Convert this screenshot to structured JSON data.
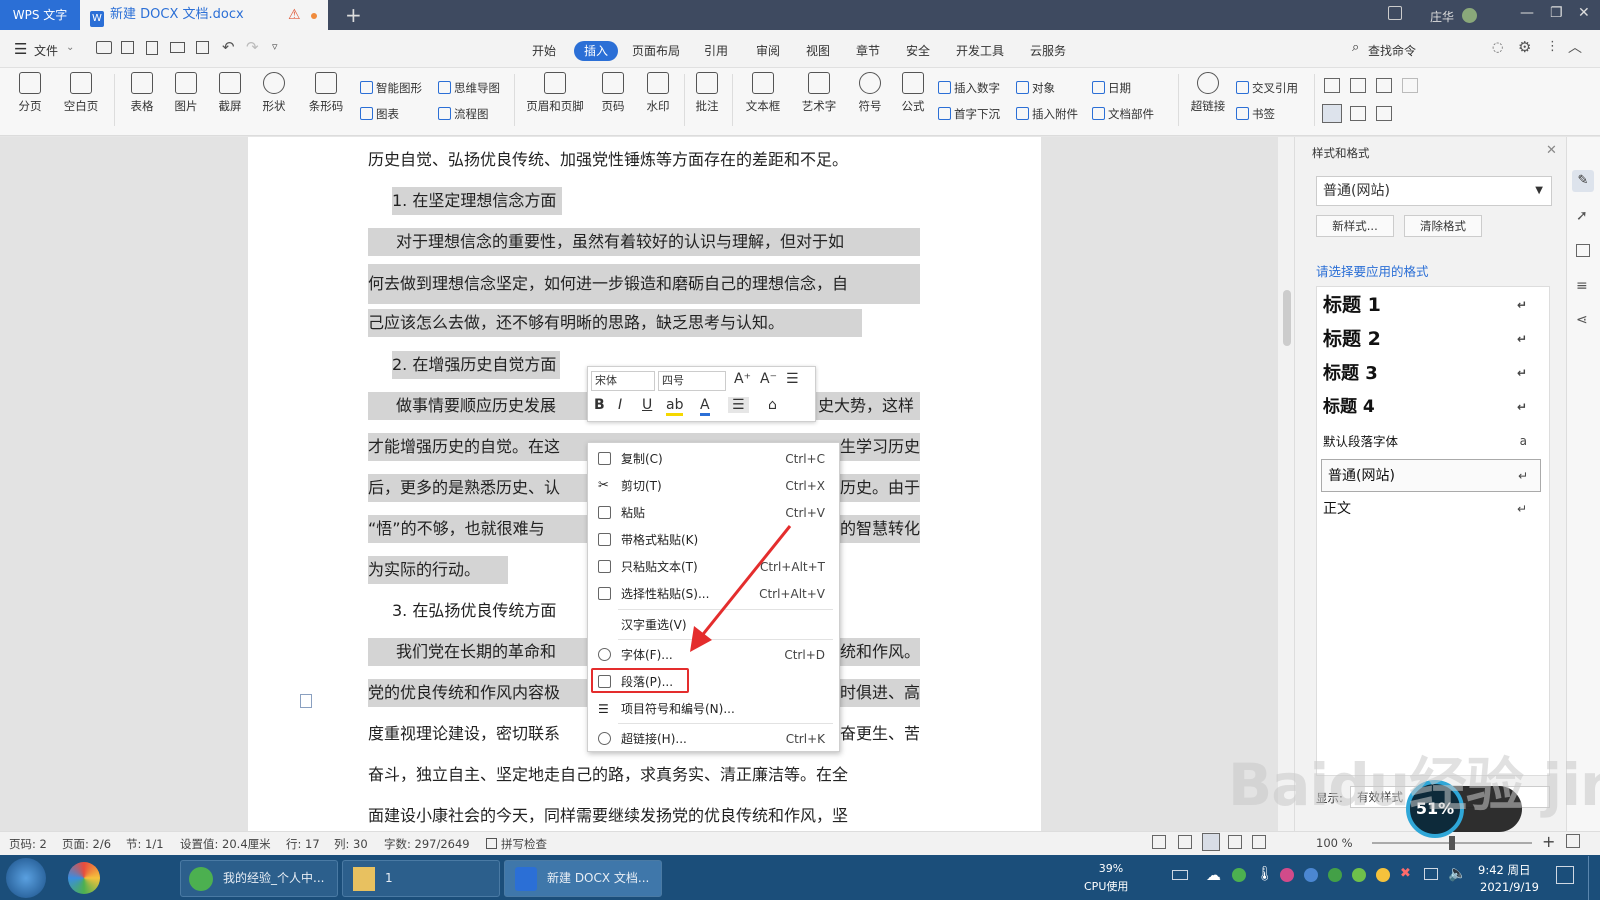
{
  "titlebar": {
    "app_name": "WPS 文字",
    "doc_tab": "新建 DOCX 文档.docx",
    "user": "庄华",
    "add": "+"
  },
  "menubar": {
    "file": "文件",
    "tabs": [
      "开始",
      "插入",
      "页面布局",
      "引用",
      "审阅",
      "视图",
      "章节",
      "安全",
      "开发工具",
      "云服务"
    ],
    "active_tab": "插入",
    "search": "查找命令"
  },
  "ribbon": {
    "big": [
      "分页",
      "空白页",
      "表格",
      "图片",
      "截屏",
      "形状",
      "条形码"
    ],
    "small1": [
      "智能图形",
      "思维导图",
      "图表",
      "流程图"
    ],
    "big2": [
      "页眉和页脚",
      "页码",
      "水印",
      "批注",
      "文本框",
      "艺术字",
      "符号",
      "公式"
    ],
    "small2": [
      "插入数字",
      "对象",
      "日期",
      "首字下沉",
      "插入附件",
      "文档部件"
    ],
    "big3": [
      "超链接"
    ],
    "small3": [
      "交叉引用",
      "书签"
    ]
  },
  "document": {
    "lines": [
      "历史自觉、弘扬优良传统、加强党性锤炼等方面存在的差距和不足。",
      "1. 在坚定理想信念方面",
      "对于理想信念的重要性，虽然有着较好的认识与理解，但对于如",
      "何去做到理想信念坚定，如何进一步锻造和磨砺自己的理想信念，自",
      "己应该怎么去做，还不够有明晰的思路，缺乏思考与认知。",
      "2. 在增强历史自觉方面",
      "做事情要顺应历史发展",
      "史大势，这样",
      "才能增强历史的自觉。在这",
      "生学习历史",
      "后，更多的是熟悉历史、认",
      "历史。由于",
      "“悟”的不够，也就很难与",
      "的智慧转化",
      "为实际的行动。",
      "3. 在弘扬优良传统方面",
      "我们党在长期的革命和",
      "统和作风。",
      "党的优良传统和作风内容极",
      "时俱进、高",
      "度重视理论建设，密切联系",
      "奋更生、苦",
      "奋斗，独立自主、坚定地走自己的路，求真务实、清正廉洁等。在全",
      "面建设小康社会的今天，同样需要继续发扬党的优良传统和作风，坚"
    ]
  },
  "mini_toolbar": {
    "font": "宋体",
    "size": "四号"
  },
  "context_menu": {
    "items": [
      {
        "label": "复制(C)",
        "key": "Ctrl+C"
      },
      {
        "label": "剪切(T)",
        "key": "Ctrl+X"
      },
      {
        "label": "粘贴",
        "key": "Ctrl+V"
      },
      {
        "label": "带格式粘贴(K)",
        "key": ""
      },
      {
        "label": "只粘贴文本(T)",
        "key": "Ctrl+Alt+T"
      },
      {
        "label": "选择性粘贴(S)...",
        "key": "Ctrl+Alt+V"
      },
      {
        "label": "汉字重选(V)",
        "key": ""
      },
      {
        "label": "字体(F)...",
        "key": "Ctrl+D"
      },
      {
        "label": "段落(P)...",
        "key": ""
      },
      {
        "label": "项目符号和编号(N)...",
        "key": ""
      },
      {
        "label": "超链接(H)...",
        "key": "Ctrl+K"
      }
    ]
  },
  "styles_panel": {
    "title": "样式和格式",
    "current": "普通(网站)",
    "new_style": "新样式...",
    "clear_format": "清除格式",
    "prompt": "请选择要应用的格式",
    "styles": [
      "标题 1",
      "标题 2",
      "标题 3",
      "标题 4",
      "默认段落字体",
      "普通(网站)",
      "正文"
    ],
    "show_label": "显示:",
    "show_value": "有效样式"
  },
  "statusbar": {
    "items": [
      "页码: 2",
      "页面: 2/6",
      "节: 1/1",
      "设置值: 20.4厘米",
      "行: 17",
      "列: 30",
      "字数: 297/2649",
      "拼写检查"
    ],
    "zoom": "100 %"
  },
  "taskbar": {
    "tasks": [
      "我的经验_个人中...",
      "1",
      "新建 DOCX 文档..."
    ],
    "cpu_percent": "39%",
    "cpu_label": "CPU使用",
    "time": "9:42 周日",
    "date": "2021/9/19",
    "cpu_gauge": "51%"
  },
  "watermark": "Baidu经验 jingyan.baidu.com",
  "colors": {
    "accent": "#2b6fd6",
    "highlight_box": "#e42d2d",
    "arrow": "#e42d2d"
  }
}
